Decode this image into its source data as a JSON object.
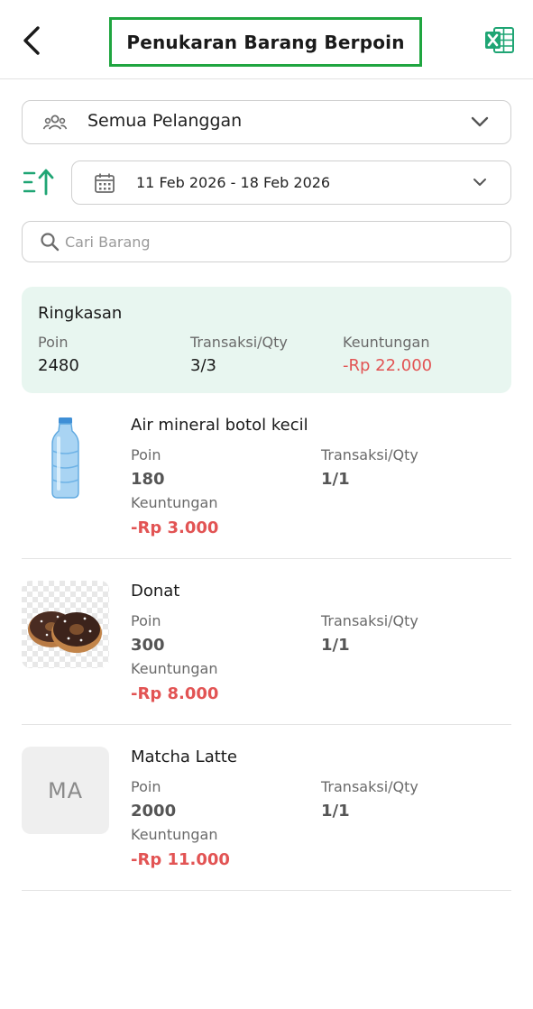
{
  "header": {
    "title": "Penukaran Barang Berpoin",
    "back_icon": "chevron-left-icon",
    "export_icon": "excel-icon",
    "accent_color": "#1fa540"
  },
  "filters": {
    "customer": {
      "value": "Semua Pelanggan",
      "icon": "people-icon"
    },
    "sort_icon": "sort-ascending-icon",
    "date_range": {
      "value": "11 Feb 2026 - 18 Feb 2026",
      "icon": "calendar-icon"
    },
    "search": {
      "placeholder": "Cari Barang",
      "value": ""
    }
  },
  "summary": {
    "title": "Ringkasan",
    "poin_label": "Poin",
    "poin_value": "2480",
    "transaksi_label": "Transaksi/Qty",
    "transaksi_value": "3/3",
    "keuntungan_label": "Keuntungan",
    "keuntungan_value": "-Rp 22.000",
    "background": "#e8f6f0",
    "negative_color": "#e25454"
  },
  "items": [
    {
      "name": "Air mineral botol kecil",
      "image": "water-bottle-image",
      "poin_label": "Poin",
      "poin": "180",
      "transaksi_label": "Transaksi/Qty",
      "transaksi": "1/1",
      "keuntungan_label": "Keuntungan",
      "keuntungan": "-Rp 3.000"
    },
    {
      "name": "Donat",
      "image": "donut-image",
      "poin_label": "Poin",
      "poin": "300",
      "transaksi_label": "Transaksi/Qty",
      "transaksi": "1/1",
      "keuntungan_label": "Keuntungan",
      "keuntungan": "-Rp 8.000"
    },
    {
      "name": "Matcha Latte",
      "initials": "MA",
      "poin_label": "Poin",
      "poin": "2000",
      "transaksi_label": "Transaksi/Qty",
      "transaksi": "1/1",
      "keuntungan_label": "Keuntungan",
      "keuntungan": "-Rp 11.000"
    }
  ]
}
